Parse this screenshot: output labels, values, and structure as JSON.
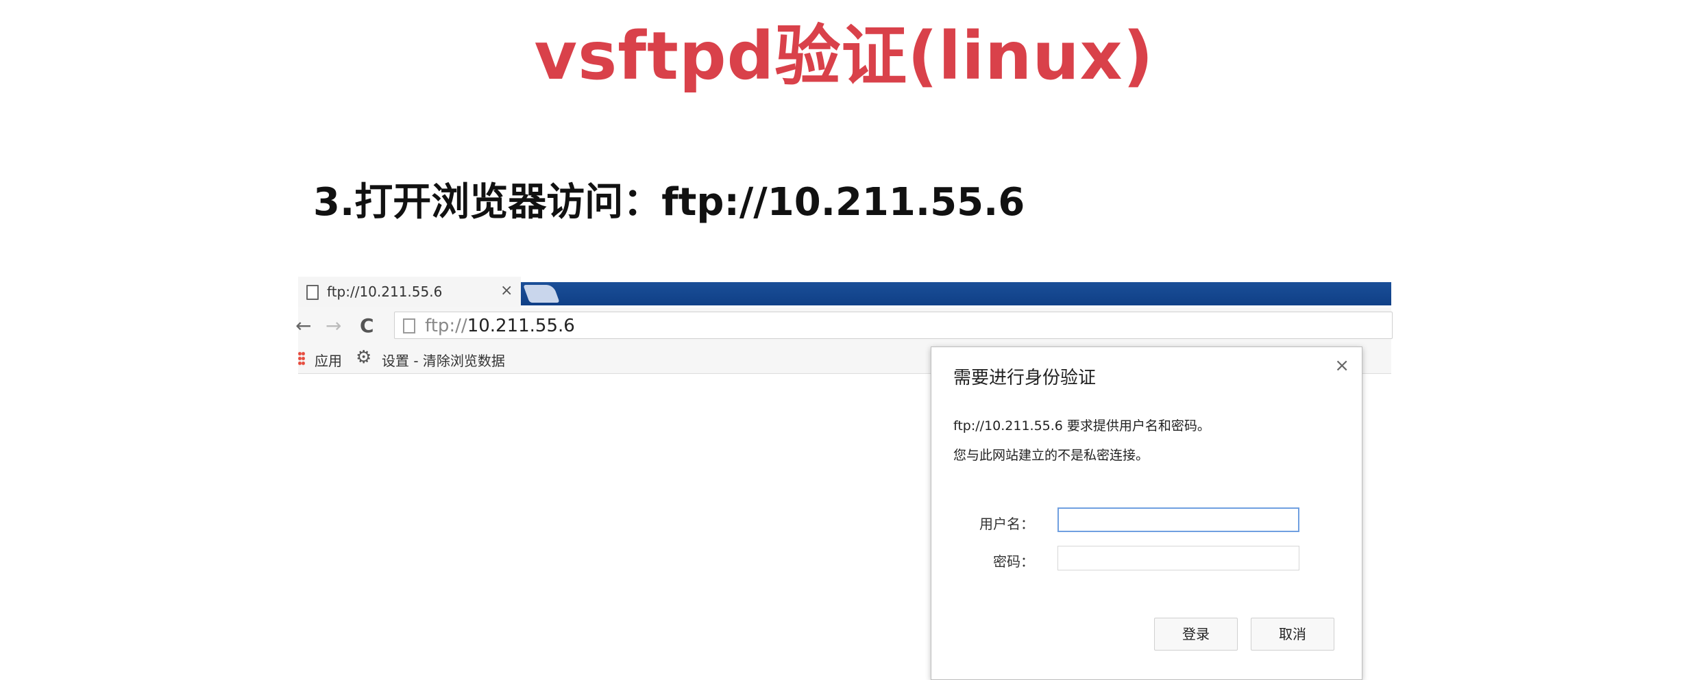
{
  "slide": {
    "title": "vsftpd验证(linux)",
    "step_heading": "3.打开浏览器访问：ftp://10.211.55.6"
  },
  "browser": {
    "tab": {
      "title": "ftp://10.211.55.6",
      "close_glyph": "×",
      "icon": "page-icon"
    },
    "toolbar": {
      "back_glyph": "←",
      "forward_glyph": "→",
      "reload_glyph": "C",
      "address_scheme": "ftp://",
      "address_host": "10.211.55.6"
    },
    "bookmarks": {
      "apps_label": "应用",
      "settings_label": "设置 - 清除浏览数据",
      "settings_glyph": "⚙"
    }
  },
  "auth_dialog": {
    "title": "需要进行身份验证",
    "close_glyph": "×",
    "message_line1": "ftp://10.211.55.6 要求提供用户名和密码。",
    "message_line2": "您与此网站建立的不是私密连接。",
    "username_label": "用户名：",
    "username_value": "",
    "password_label": "密码：",
    "password_value": "",
    "login_button": "登录",
    "cancel_button": "取消"
  },
  "colors": {
    "title_red": "#d9414a",
    "tab_strip_blue": "#1b4f98",
    "focus_border": "#6f9fe0"
  }
}
